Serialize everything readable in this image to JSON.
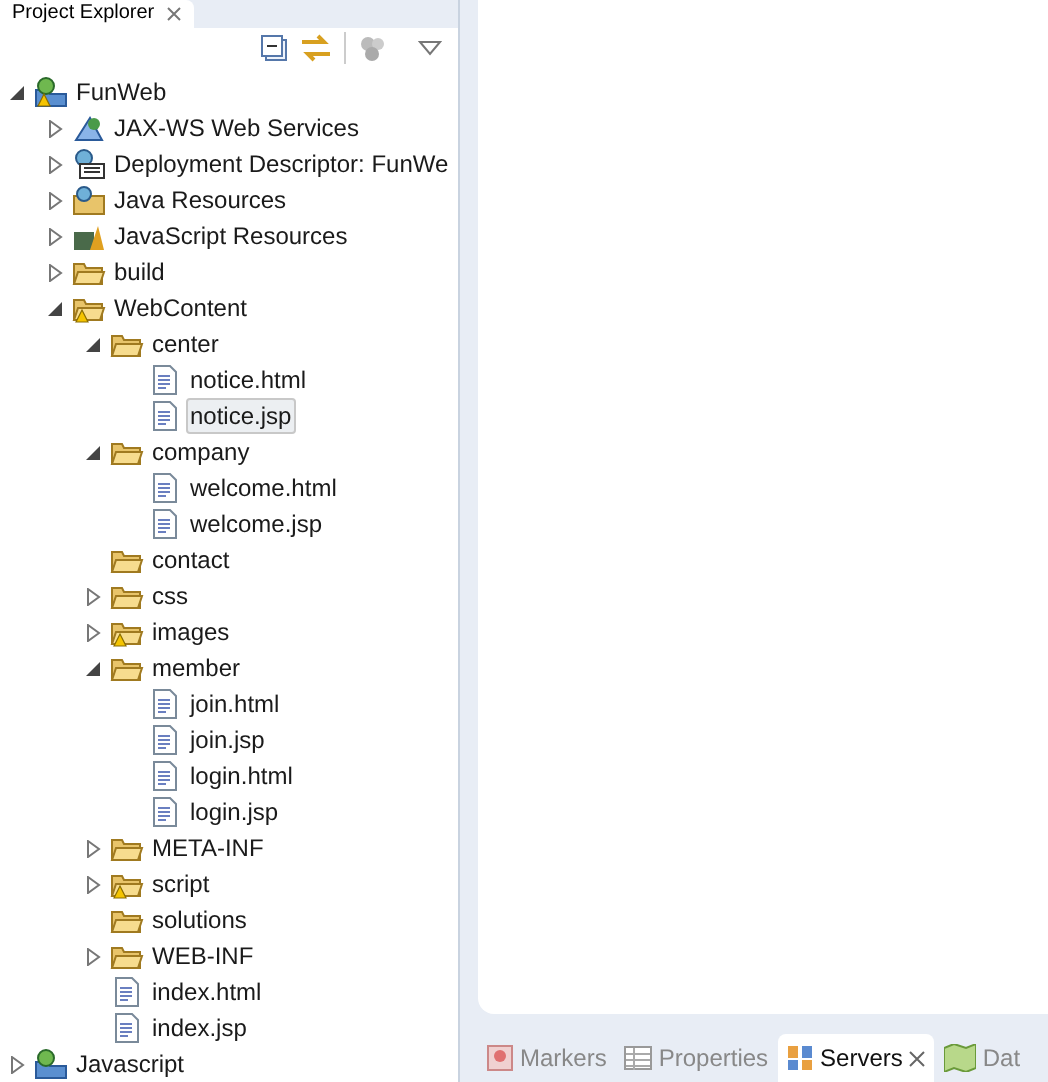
{
  "explorer": {
    "title": "Project Explorer",
    "tree": [
      {
        "label": "FunWeb",
        "kind": "project",
        "expanded": true,
        "selected": false,
        "warning": true,
        "children": [
          {
            "label": "JAX-WS Web Services",
            "kind": "webservices",
            "expanded": false,
            "selected": false,
            "warning": false
          },
          {
            "label": "Deployment Descriptor: FunWe",
            "kind": "descriptor",
            "expanded": false,
            "selected": false,
            "warning": false
          },
          {
            "label": "Java Resources",
            "kind": "java-resources",
            "expanded": false,
            "selected": false,
            "warning": false
          },
          {
            "label": "JavaScript Resources",
            "kind": "js-resources",
            "expanded": false,
            "selected": false,
            "warning": false
          },
          {
            "label": "build",
            "kind": "folder",
            "expanded": false,
            "selected": false,
            "warning": false
          },
          {
            "label": "WebContent",
            "kind": "folder",
            "expanded": true,
            "selected": false,
            "warning": true,
            "children": [
              {
                "label": "center",
                "kind": "folder",
                "expanded": true,
                "selected": false,
                "warning": false,
                "children": [
                  {
                    "label": "notice.html",
                    "kind": "file",
                    "selected": false,
                    "warning": false
                  },
                  {
                    "label": "notice.jsp",
                    "kind": "file",
                    "selected": true,
                    "warning": false
                  }
                ]
              },
              {
                "label": "company",
                "kind": "folder",
                "expanded": true,
                "selected": false,
                "warning": false,
                "children": [
                  {
                    "label": "welcome.html",
                    "kind": "file",
                    "selected": false,
                    "warning": false
                  },
                  {
                    "label": "welcome.jsp",
                    "kind": "file",
                    "selected": false,
                    "warning": false
                  }
                ]
              },
              {
                "label": "contact",
                "kind": "folder",
                "selected": false,
                "warning": false
              },
              {
                "label": "css",
                "kind": "folder",
                "expanded": false,
                "selected": false,
                "warning": false
              },
              {
                "label": "images",
                "kind": "folder",
                "expanded": false,
                "selected": false,
                "warning": true
              },
              {
                "label": "member",
                "kind": "folder",
                "expanded": true,
                "selected": false,
                "warning": false,
                "children": [
                  {
                    "label": "join.html",
                    "kind": "file",
                    "selected": false,
                    "warning": false
                  },
                  {
                    "label": "join.jsp",
                    "kind": "file",
                    "selected": false,
                    "warning": false
                  },
                  {
                    "label": "login.html",
                    "kind": "file",
                    "selected": false,
                    "warning": false
                  },
                  {
                    "label": "login.jsp",
                    "kind": "file",
                    "selected": false,
                    "warning": false
                  }
                ]
              },
              {
                "label": "META-INF",
                "kind": "folder",
                "expanded": false,
                "selected": false,
                "warning": false
              },
              {
                "label": "script",
                "kind": "folder",
                "expanded": false,
                "selected": false,
                "warning": true
              },
              {
                "label": "solutions",
                "kind": "folder",
                "selected": false,
                "warning": false
              },
              {
                "label": "WEB-INF",
                "kind": "folder",
                "expanded": false,
                "selected": false,
                "warning": false
              },
              {
                "label": "index.html",
                "kind": "file",
                "selected": false,
                "warning": false
              },
              {
                "label": "index.jsp",
                "kind": "file",
                "selected": false,
                "warning": false
              }
            ]
          }
        ]
      },
      {
        "label": "Javascript",
        "kind": "project",
        "expanded": false,
        "selected": false,
        "warning": false
      }
    ]
  },
  "bottom_tabs": [
    {
      "label": "Markers",
      "kind": "markers",
      "selected": false
    },
    {
      "label": "Properties",
      "kind": "properties",
      "selected": false
    },
    {
      "label": "Servers",
      "kind": "servers",
      "selected": true
    },
    {
      "label": "Dat",
      "kind": "data",
      "selected": false
    }
  ]
}
